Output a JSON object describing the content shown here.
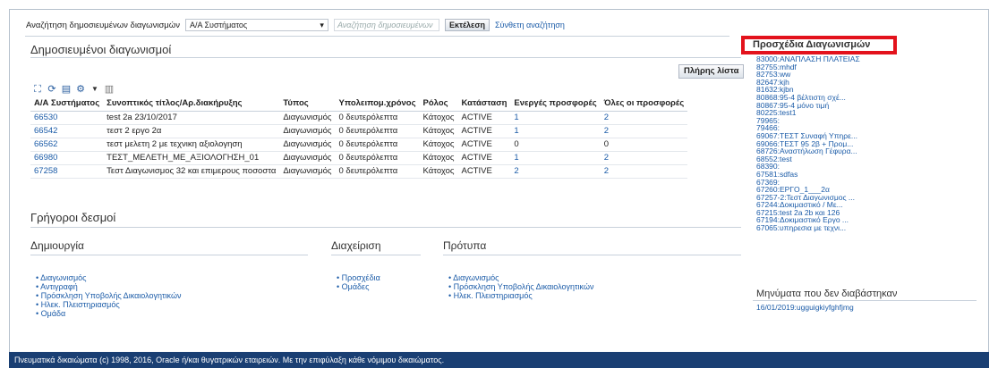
{
  "search": {
    "label": "Αναζήτηση δημοσιευμένων διαγωνισμών",
    "select_value": "Α/Α Συστήματος",
    "input_placeholder": "Αναζήτηση δημοσιευμένων",
    "execute_label": "Εκτέλεση",
    "advanced_label": "Σύνθετη αναζήτηση"
  },
  "published": {
    "title": "Δημοσιευμένοι διαγωνισμοί",
    "full_list_label": "Πλήρης λίστα",
    "columns": [
      "Α/Α Συστήματος",
      "Συνοπτικός τίτλος/Αρ.διακήρυξης",
      "Τύπος",
      "Υπολειπομ.χρόνος",
      "Ρόλος",
      "Κατάσταση",
      "Ενεργές προσφορές",
      "Όλες οι προσφορές"
    ],
    "rows": [
      [
        "66530",
        "test 2a 23/10/2017",
        "Διαγωνισμός",
        "0 δευτερόλεπτα",
        "Κάτοχος",
        "ACTIVE",
        "1",
        "2"
      ],
      [
        "66542",
        "τεστ 2 εργο 2α",
        "Διαγωνισμός",
        "0 δευτερόλεπτα",
        "Κάτοχος",
        "ACTIVE",
        "1",
        "2"
      ],
      [
        "66562",
        "τεστ μελετη 2 με τεχνικη αξιολογηση",
        "Διαγωνισμός",
        "0 δευτερόλεπτα",
        "Κάτοχος",
        "ACTIVE",
        "0",
        "0"
      ],
      [
        "66980",
        "ΤΕΣΤ_ΜΕΛΕΤΗ_ΜΕ_ΑΞΙΟΛΟΓΗΣΗ_01",
        "Διαγωνισμός",
        "0 δευτερόλεπτα",
        "Κάτοχος",
        "ACTIVE",
        "1",
        "2"
      ],
      [
        "67258",
        "Τεστ Διαγωνισμος 32 και επιμερους ποσοστα",
        "Διαγωνισμός",
        "0 δευτερόλεπτα",
        "Κάτοχος",
        "ACTIVE",
        "2",
        "2"
      ]
    ]
  },
  "quick_links": {
    "title": "Γρήγοροι δεσμοί",
    "create": {
      "title": "Δημιουργία",
      "items": [
        "Διαγωνισμός",
        "Αντιγραφή",
        "Πρόσκληση Υποβολής Δικαιολογητικών",
        "Ηλεκ. Πλειστηριασμός",
        "Ομάδα"
      ]
    },
    "manage": {
      "title": "Διαχείριση",
      "items": [
        "Προσχέδια",
        "Ομάδες"
      ]
    },
    "templates": {
      "title": "Πρότυπα",
      "items": [
        "Διαγωνισμός",
        "Πρόσκληση Υποβολής Δικαιολογητικών",
        "Ηλεκ. Πλειστηριασμός"
      ]
    }
  },
  "drafts": {
    "title": "Προσχέδια Διαγωνισμών",
    "items": [
      "83000:ΑΝΑΠΛΑΣΗ ΠΛΑΤΕΙΑΣ",
      "82755:mhdf",
      "82753:ww",
      "82647:kjh",
      "81632:kjbn",
      "80868:95-4 βέλτιστη σχέ...",
      "80867:95-4 μόνο τιμή",
      "80225:test1",
      "79965:",
      "79466:",
      "69067:ΤΕΣΤ Συναφή Υπηρε...",
      "69066:ΤΕΣΤ 95 2β + Προμ...",
      "68726:Αναστήλωση Γέφυρα...",
      "68552:test",
      "68390:",
      "67581:sdfas",
      "67369:",
      "67260:ΕΡΓΟ_1___2α",
      "67257-2:Τεστ Διαγωνισμος ...",
      "67244:Δοκιμαστικό / Με...",
      "67215:test 2a 2b και 126",
      "67194:Δοκιμαστικό Εργο ...",
      "67065:υπηρεσια με τεχνι..."
    ]
  },
  "unread": {
    "title": "Μηνύματα που δεν διαβάστηκαν",
    "items": [
      "16/01/2019:ugguigkiyfghfjmg"
    ]
  },
  "footer": {
    "text": "Πνευματικά δικαιώματα (c) 1998, 2016, Oracle ή/και θυγατρικών εταιρειών. Με την επιφύλαξη κάθε νόμιμου δικαιώματος."
  },
  "colors": {
    "link": "#1c5ca8",
    "footer_bg": "#1a3f73",
    "highlight_box": "#e3121c"
  },
  "icons": [
    "maximize-icon",
    "refresh-icon",
    "export-icon",
    "settings-icon",
    "dropdown-caret-icon",
    "columns-icon"
  ]
}
